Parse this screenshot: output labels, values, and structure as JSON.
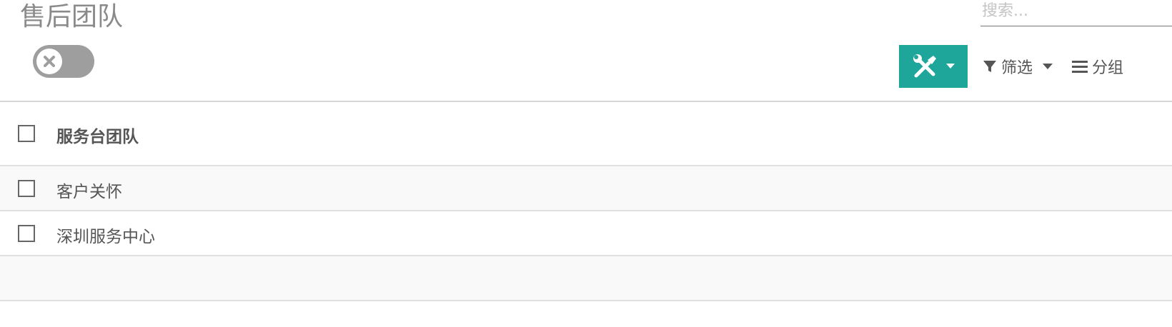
{
  "page": {
    "title": "售后团队"
  },
  "search": {
    "placeholder": "搜索..."
  },
  "toolbar": {
    "tools_icon": "wrench-screwdriver-icon",
    "filter_label": "筛选",
    "group_label": "分组"
  },
  "colors": {
    "accent": "#1ea69a",
    "toggle_off": "#9e9e9e"
  },
  "table": {
    "column_header": "服务台团队",
    "rows": [
      {
        "name": "客户关怀"
      },
      {
        "name": "深圳服务中心"
      }
    ]
  }
}
